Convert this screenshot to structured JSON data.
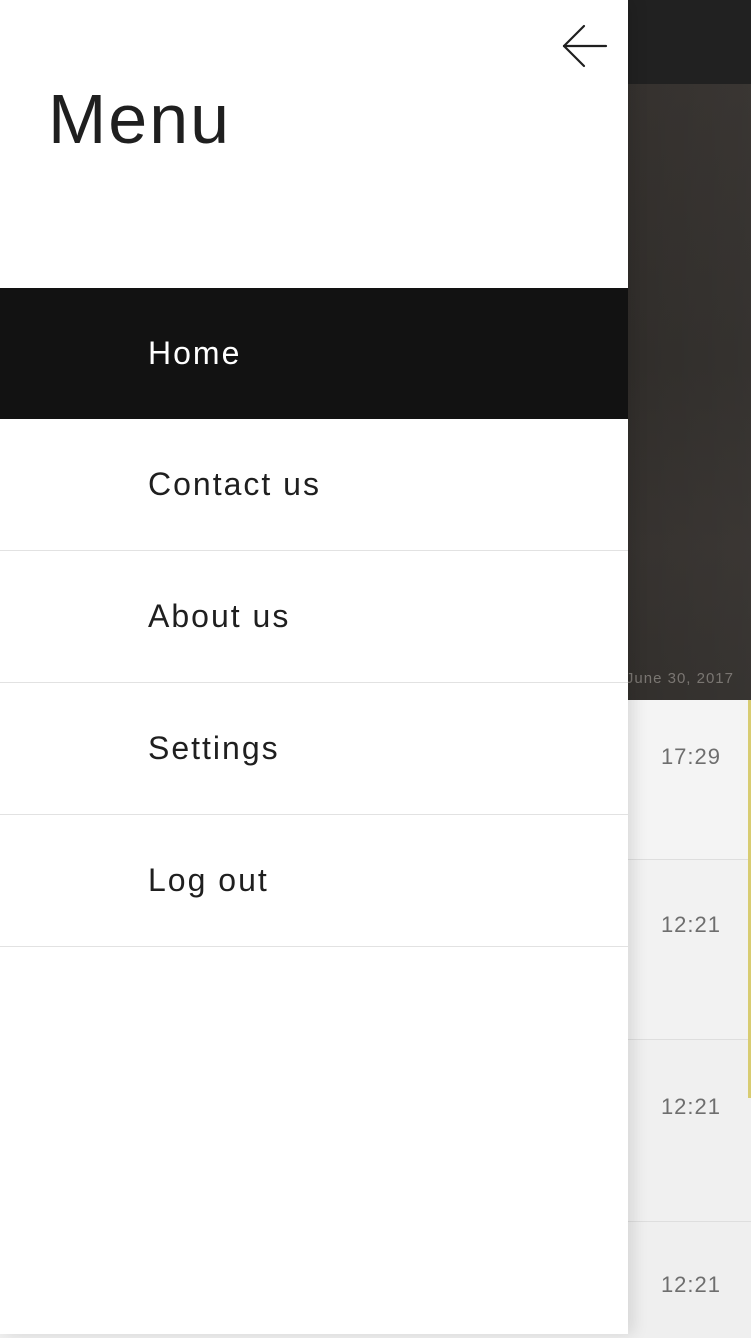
{
  "drawer": {
    "title": "Menu",
    "back_icon": "arrow-left-icon",
    "items": [
      {
        "label": "Home",
        "active": true
      },
      {
        "label": "Contact us",
        "active": false
      },
      {
        "label": "About us",
        "active": false
      },
      {
        "label": "Settings",
        "active": false
      },
      {
        "label": "Log out",
        "active": false
      }
    ]
  },
  "background": {
    "hero_date": "June 30, 2017",
    "rows": [
      {
        "time": "17:29"
      },
      {
        "time": "12:21"
      },
      {
        "time": "12:21"
      },
      {
        "time": "12:21"
      }
    ]
  },
  "colors": {
    "drawer_bg": "#ffffff",
    "active_item_bg": "#121212",
    "active_item_text": "#ffffff",
    "topbar_bg": "#212121",
    "accent": "#d8cc72"
  }
}
